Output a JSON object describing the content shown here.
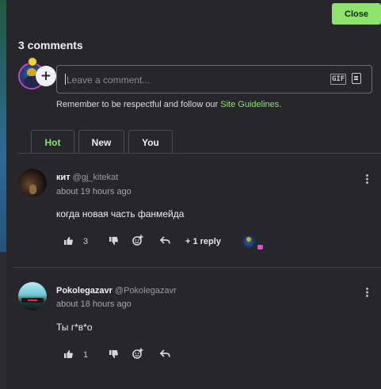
{
  "header": {
    "close_label": "Close",
    "comment_count": "3 comments"
  },
  "composer": {
    "placeholder": "Leave a comment...",
    "gif_label": "GIF",
    "guidelines_prefix": "Remember to be respectful and follow our ",
    "guidelines_link": "Site Guidelines",
    "guidelines_suffix": "."
  },
  "tabs": [
    {
      "label": "Hot"
    },
    {
      "label": "New"
    },
    {
      "label": "You"
    }
  ],
  "comments": [
    {
      "username": "кит",
      "handle": "@gj_kitekat",
      "time": "about 19 hours ago",
      "text": "когда новая часть фанмейда",
      "likes": "3",
      "replies": "+ 1 reply"
    },
    {
      "username": "Pokolegazavr",
      "handle": "@Pokolegazavr",
      "time": "about 18 hours ago",
      "text": "Ты г*в*о",
      "likes": "1"
    }
  ],
  "colors": {
    "accent": "#8ee36d",
    "panel": "#26262b",
    "avatar_ring": "#c542d4"
  }
}
